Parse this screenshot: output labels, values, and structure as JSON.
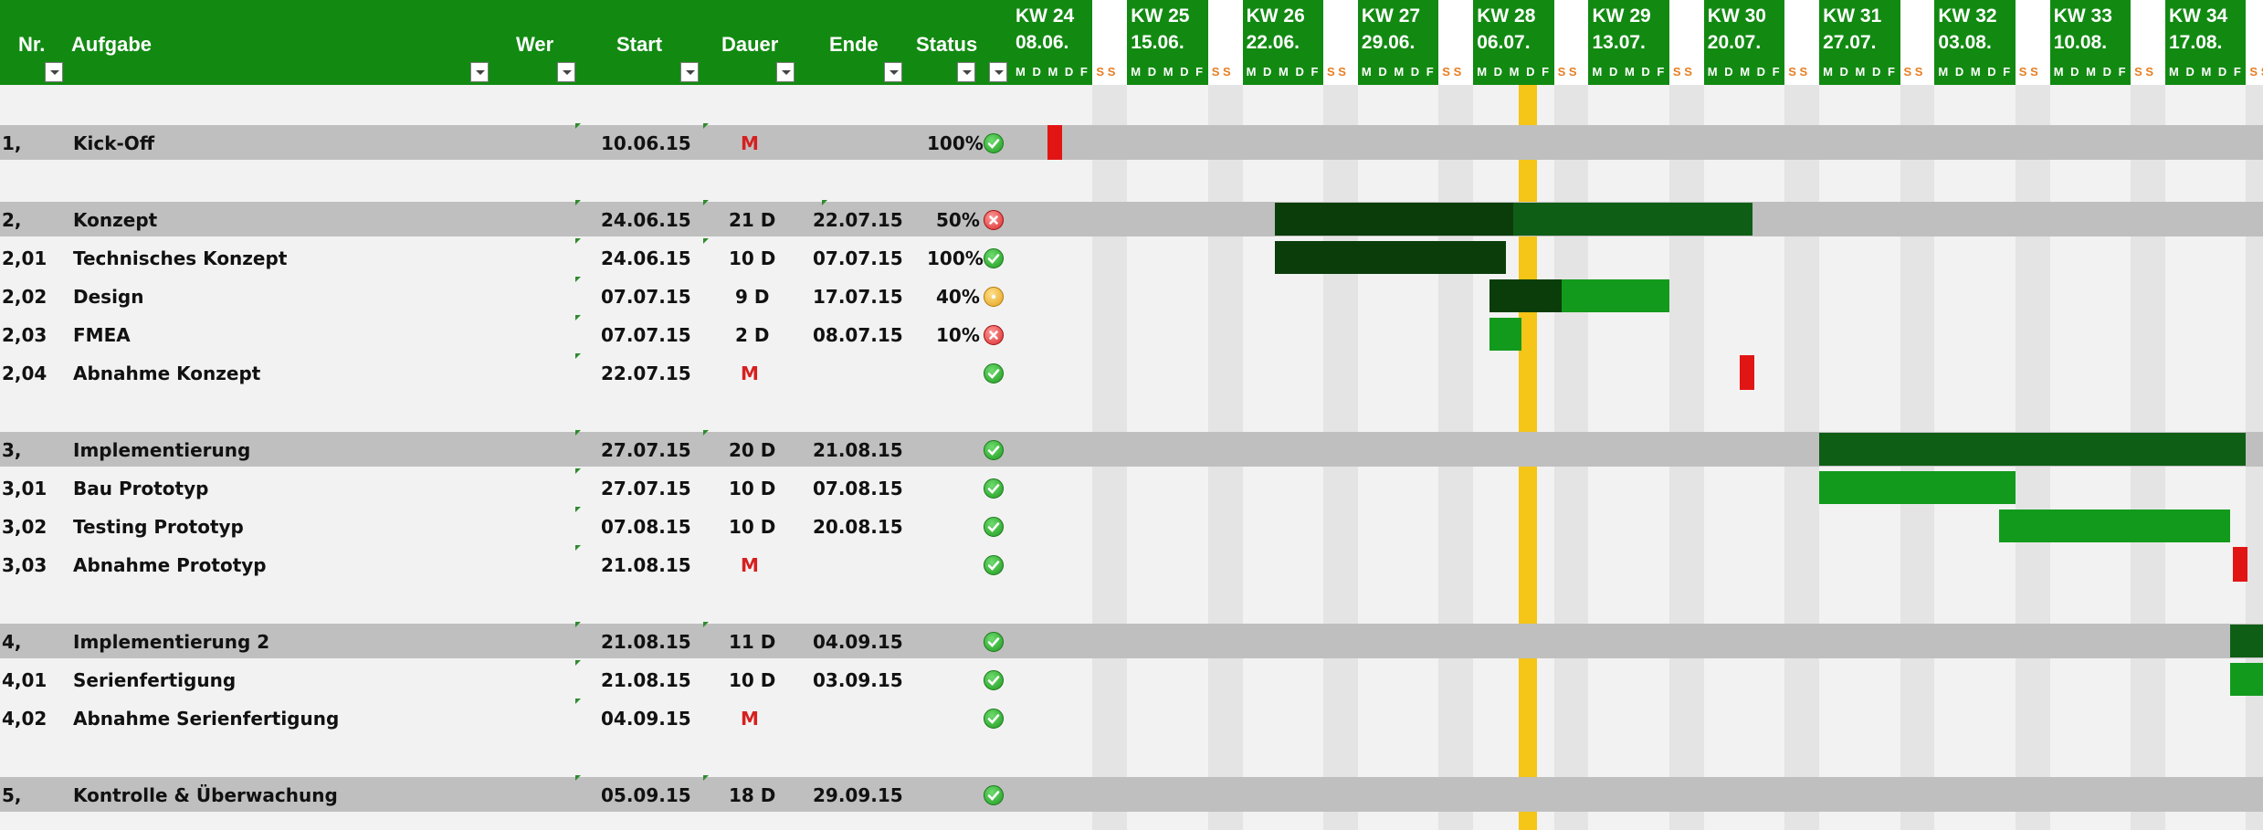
{
  "header": {
    "nr": "Nr.",
    "aufgabe": "Aufgabe",
    "wer": "Wer",
    "start": "Start",
    "dauer": "Dauer",
    "ende": "Ende",
    "status": "Status"
  },
  "weeks": [
    {
      "kw": "KW 24",
      "date": "08.06.",
      "days": "M D M D F"
    },
    {
      "kw": "KW 25",
      "date": "15.06.",
      "days": "M D M D F"
    },
    {
      "kw": "KW 26",
      "date": "22.06.",
      "days": "M D M D F"
    },
    {
      "kw": "KW 27",
      "date": "29.06.",
      "days": "M D M D F"
    },
    {
      "kw": "KW 28",
      "date": "06.07.",
      "days": "M D M D F"
    },
    {
      "kw": "KW 29",
      "date": "13.07.",
      "days": "M D M D F"
    },
    {
      "kw": "KW 30",
      "date": "20.07.",
      "days": "M D M D F"
    },
    {
      "kw": "KW 31",
      "date": "27.07.",
      "days": "M D M D F"
    },
    {
      "kw": "KW 32",
      "date": "03.08.",
      "days": "M D M D F"
    },
    {
      "kw": "KW 33",
      "date": "10.08.",
      "days": "M D M D F"
    },
    {
      "kw": "KW 34",
      "date": "17.08.",
      "days": "M D M D F"
    }
  ],
  "weekend_label": "S S",
  "rows": [
    {
      "type": "blank"
    },
    {
      "type": "grp",
      "nr": "1,",
      "task": "Kick-Off",
      "start": "10.06.15",
      "dauer": "M",
      "milestone": true,
      "ende": "",
      "pct": "100%",
      "status": "ok"
    },
    {
      "type": "blank"
    },
    {
      "type": "grp",
      "nr": "2,",
      "task": "Konzept",
      "start": "24.06.15",
      "dauer": "21 D",
      "ende": "22.07.15",
      "pct": "50%",
      "status": "err"
    },
    {
      "type": "task",
      "nr": "2,01",
      "task": "Technisches Konzept",
      "start": "24.06.15",
      "dauer": "10 D",
      "ende": "07.07.15",
      "pct": "100%",
      "status": "ok"
    },
    {
      "type": "task",
      "nr": "2,02",
      "task": "Design",
      "start": "07.07.15",
      "dauer": "9 D",
      "ende": "17.07.15",
      "pct": "40%",
      "status": "warn"
    },
    {
      "type": "task",
      "nr": "2,03",
      "task": "FMEA",
      "start": "07.07.15",
      "dauer": "2 D",
      "ende": "08.07.15",
      "pct": "10%",
      "status": "err"
    },
    {
      "type": "task",
      "nr": "2,04",
      "task": "Abnahme Konzept",
      "start": "22.07.15",
      "dauer": "M",
      "milestone": true,
      "ende": "",
      "pct": "",
      "status": "ok"
    },
    {
      "type": "blank"
    },
    {
      "type": "grp",
      "nr": "3,",
      "task": "Implementierung",
      "start": "27.07.15",
      "dauer": "20 D",
      "ende": "21.08.15",
      "pct": "",
      "status": "ok"
    },
    {
      "type": "task",
      "nr": "3,01",
      "task": "Bau Prototyp",
      "start": "27.07.15",
      "dauer": "10 D",
      "ende": "07.08.15",
      "pct": "",
      "status": "ok"
    },
    {
      "type": "task",
      "nr": "3,02",
      "task": "Testing Prototyp",
      "start": "07.08.15",
      "dauer": "10 D",
      "ende": "20.08.15",
      "pct": "",
      "status": "ok"
    },
    {
      "type": "task",
      "nr": "3,03",
      "task": "Abnahme Prototyp",
      "start": "21.08.15",
      "dauer": "M",
      "milestone": true,
      "ende": "",
      "pct": "",
      "status": "ok"
    },
    {
      "type": "blank"
    },
    {
      "type": "grp",
      "nr": "4,",
      "task": "Implementierung 2",
      "start": "21.08.15",
      "dauer": "11 D",
      "ende": "04.09.15",
      "pct": "",
      "status": "ok"
    },
    {
      "type": "task",
      "nr": "4,01",
      "task": "Serienfertigung",
      "start": "21.08.15",
      "dauer": "10 D",
      "ende": "03.09.15",
      "pct": "",
      "status": "ok"
    },
    {
      "type": "task",
      "nr": "4,02",
      "task": "Abnahme Serienfertigung",
      "start": "04.09.15",
      "dauer": "M",
      "milestone": true,
      "ende": "",
      "pct": "",
      "status": "ok"
    },
    {
      "type": "blank"
    },
    {
      "type": "grp",
      "nr": "5,",
      "task": "Kontrolle & Überwachung",
      "start": "05.09.15",
      "dauer": "18 D",
      "ende": "29.09.15",
      "pct": "",
      "status": "ok"
    }
  ],
  "colors": {
    "header_green": "#128a12",
    "group_row": "#bfbfbf",
    "weekend": "#e4e4e4",
    "today": "#f5c518",
    "bar_dark": "#0b3d0b",
    "bar_mid": "#0f5e16",
    "bar_light": "#129a1c",
    "milestone": "#e21515"
  },
  "gantt": {
    "today": "09.07.15",
    "bars": [
      {
        "row": 1,
        "kind": "milestone",
        "date": "10.06.15"
      },
      {
        "row": 3,
        "kind": "progress",
        "start": "24.06.15",
        "end": "22.07.15",
        "done": 0.5,
        "done_color": "bar_dark",
        "rest_color": "bar_mid"
      },
      {
        "row": 4,
        "kind": "progress",
        "start": "24.06.15",
        "end": "07.07.15",
        "done": 1.0,
        "done_color": "bar_dark",
        "rest_color": "bar_mid"
      },
      {
        "row": 5,
        "kind": "progress",
        "start": "07.07.15",
        "end": "17.07.15",
        "done": 0.4,
        "done_color": "bar_dark",
        "rest_color": "bar_light"
      },
      {
        "row": 6,
        "kind": "progress",
        "start": "07.07.15",
        "end": "08.07.15",
        "done": 0.0,
        "done_color": "bar_dark",
        "rest_color": "bar_light"
      },
      {
        "row": 7,
        "kind": "milestone",
        "date": "22.07.15"
      },
      {
        "row": 9,
        "kind": "progress",
        "start": "27.07.15",
        "end": "21.08.15",
        "done": 0.0,
        "done_color": "bar_dark",
        "rest_color": "bar_mid"
      },
      {
        "row": 10,
        "kind": "progress",
        "start": "27.07.15",
        "end": "07.08.15",
        "done": 0.0,
        "done_color": "bar_dark",
        "rest_color": "bar_light"
      },
      {
        "row": 11,
        "kind": "progress",
        "start": "07.08.15",
        "end": "20.08.15",
        "done": 0.0,
        "done_color": "bar_dark",
        "rest_color": "bar_light"
      },
      {
        "row": 12,
        "kind": "milestone",
        "date": "21.08.15"
      },
      {
        "row": 14,
        "kind": "progress",
        "start": "21.08.15",
        "end": "04.09.15",
        "done": 0.0,
        "done_color": "bar_dark",
        "rest_color": "bar_mid"
      },
      {
        "row": 15,
        "kind": "progress",
        "start": "21.08.15",
        "end": "03.09.15",
        "done": 0.0,
        "done_color": "bar_dark",
        "rest_color": "bar_light"
      }
    ]
  }
}
